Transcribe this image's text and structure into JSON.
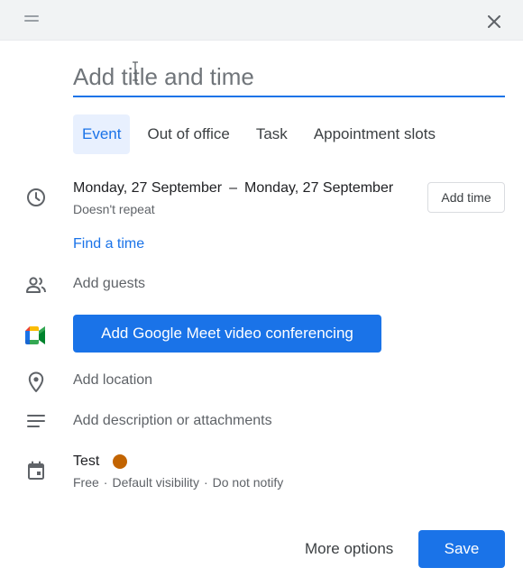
{
  "header": {
    "drag_icon": "drag-handle-icon",
    "close_icon": "close-icon"
  },
  "title": {
    "placeholder": "Add title and time",
    "value": ""
  },
  "tabs": [
    {
      "label": "Event",
      "active": true
    },
    {
      "label": "Out of office",
      "active": false
    },
    {
      "label": "Task",
      "active": false
    },
    {
      "label": "Appointment slots",
      "active": false
    }
  ],
  "datetime": {
    "start": "Monday, 27 September",
    "separator": "–",
    "end": "Monday, 27 September",
    "repeat": "Doesn't repeat",
    "add_time_label": "Add time",
    "icon": "clock-icon"
  },
  "find_time_label": "Find a time",
  "guests": {
    "label": "Add guests",
    "icon": "people-icon"
  },
  "meet": {
    "label": "Add Google Meet video conferencing",
    "icon": "google-meet-icon"
  },
  "location": {
    "label": "Add location",
    "icon": "location-pin-icon"
  },
  "description": {
    "label": "Add description or attachments",
    "icon": "notes-icon"
  },
  "calendar": {
    "name": "Test",
    "color": "#c26401",
    "availability": "Free",
    "visibility": "Default visibility",
    "notify": "Do not notify",
    "separator": "·",
    "icon": "calendar-icon"
  },
  "footer": {
    "more_options_label": "More options",
    "save_label": "Save"
  },
  "colors": {
    "accent": "#1a73e8",
    "accent_light": "#e8f0fe",
    "header_bg": "#f1f3f4"
  }
}
